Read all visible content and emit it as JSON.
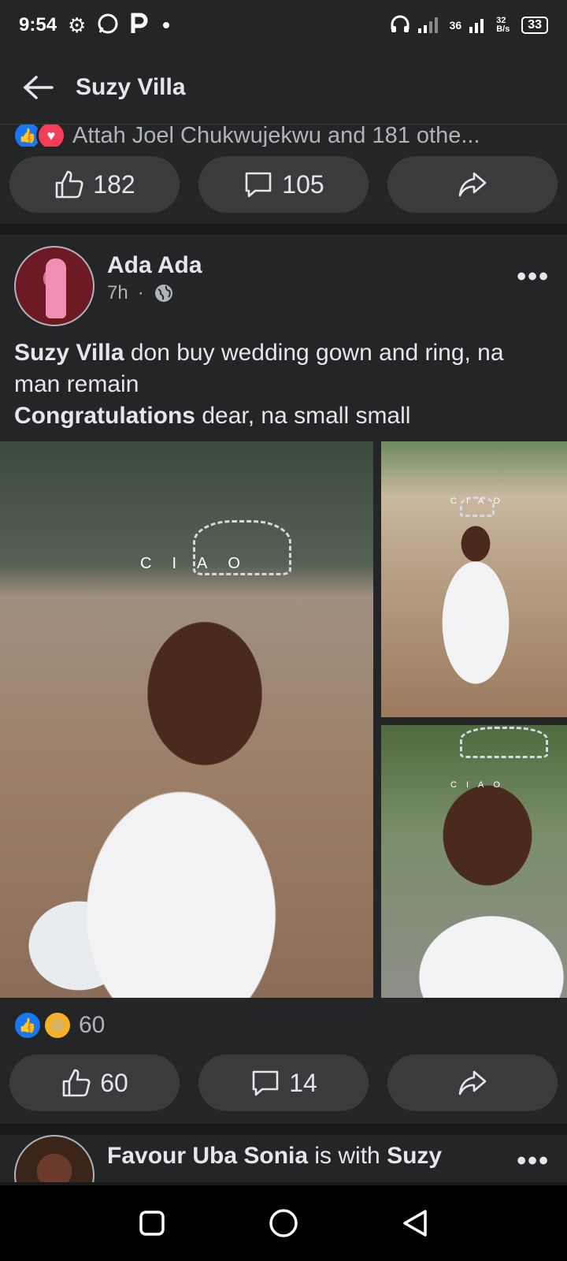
{
  "status_bar": {
    "time": "9:54",
    "battery": "33",
    "network": "36",
    "speed": "32 B/s"
  },
  "header": {
    "title": "Suzy Villa"
  },
  "post1": {
    "reactions_text": "Attah Joel Chukwujekwu and 181 othe...",
    "like_count": "182",
    "comment_count": "105"
  },
  "post2": {
    "author": "Ada Ada",
    "time": "7h",
    "text_mention": "Suzy Villa",
    "text_line1": " don buy wedding gown and ring, na man remain",
    "text_bold2": "Congratulations",
    "text_line2": " dear, na small small",
    "watermark": "CIAO",
    "reaction_count": "60",
    "like_count": "60",
    "comment_count": "14"
  },
  "post3": {
    "author": "Favour Uba Sonia",
    "with": " is with ",
    "tagged": "Suzy"
  },
  "colors": {
    "bg": "#18191a",
    "card": "#242526",
    "button": "#3a3b3c",
    "like_blue": "#1877f2",
    "love_red": "#f33e58"
  }
}
